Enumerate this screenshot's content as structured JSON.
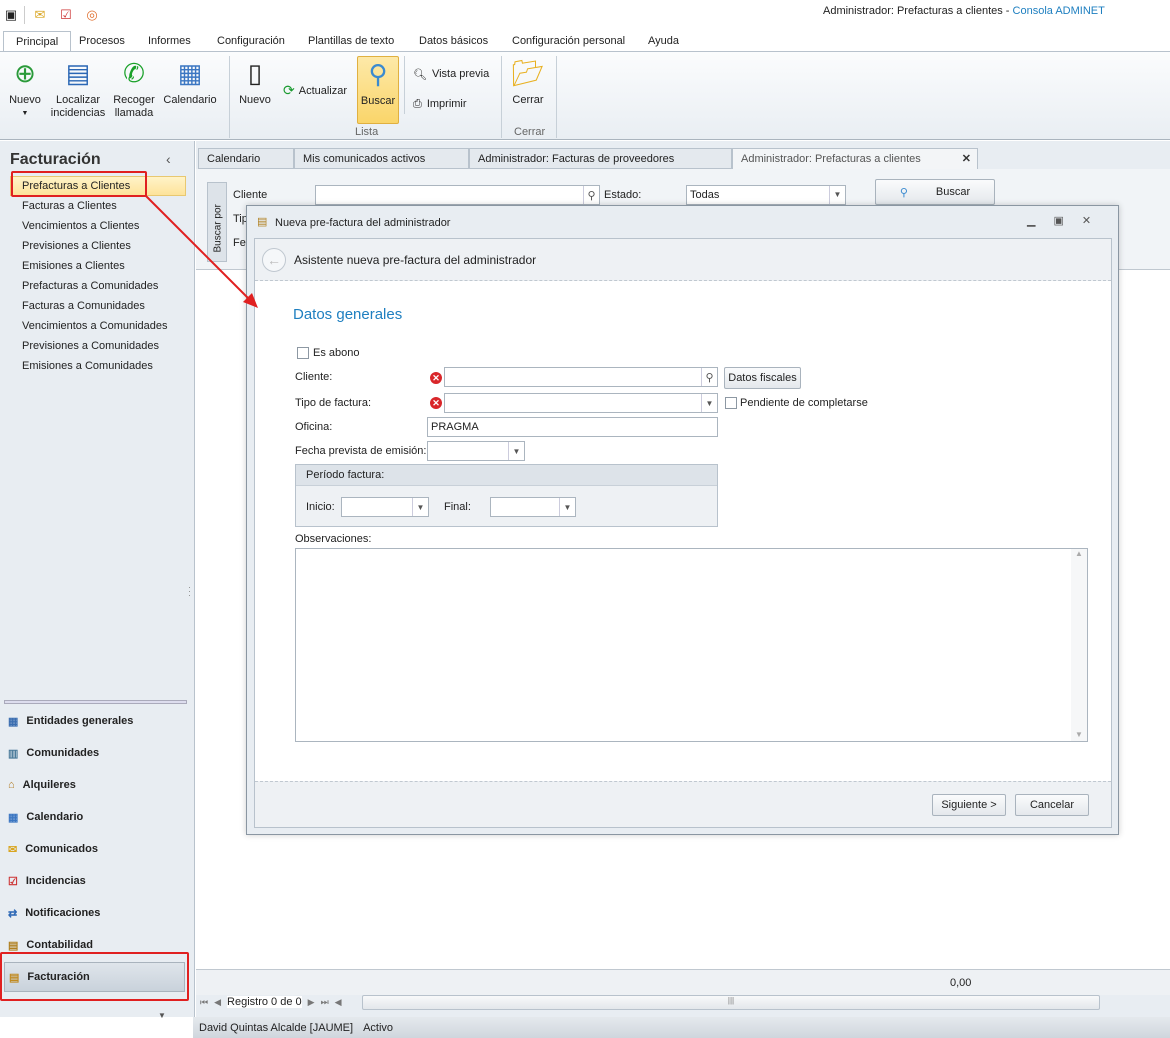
{
  "window": {
    "title": "Administrador: Prefacturas a clientes",
    "title_sep": " - ",
    "app": "Consola ADMINET"
  },
  "ribbon_tabs": [
    "Principal",
    "Procesos",
    "Informes",
    "Configuración",
    "Plantillas de texto",
    "Datos básicos",
    "Configuración personal",
    "Ayuda"
  ],
  "ribbon": {
    "nuevo": "Nuevo",
    "localizar": "Localizar incidencias",
    "recoger": "Recoger llamada",
    "calendario": "Calendario",
    "nuevo2": "Nuevo",
    "actualizar": "Actualizar",
    "buscar": "Buscar",
    "vista_previa": "Vista previa",
    "imprimir": "Imprimir",
    "lista": "Lista",
    "cerrar": "Cerrar",
    "cerrar_group": "Cerrar"
  },
  "left": {
    "title": "Facturación",
    "items": [
      "Prefacturas a Clientes",
      "Facturas a Clientes",
      "Vencimientos a Clientes",
      "Previsiones a Clientes",
      "Emisiones a Clientes",
      "Prefacturas a Comunidades",
      "Facturas a Comunidades",
      "Vencimientos a Comunidades",
      "Previsiones a Comunidades",
      "Emisiones a Comunidades"
    ],
    "modules": [
      "Entidades generales",
      "Comunidades",
      "Alquileres",
      "Calendario",
      "Comunicados",
      "Incidencias",
      "Notificaciones",
      "Contabilidad",
      "Facturación"
    ]
  },
  "doc_tabs": [
    "Calendario",
    "Mis comunicados activos",
    "Administrador: Facturas de proveedores",
    "Administrador: Prefacturas a clientes"
  ],
  "search": {
    "buscar_por": "Buscar por",
    "cliente": "Cliente",
    "tipo": "Tip",
    "fecha": "Fe",
    "estado": "Estado:",
    "estado_value": "Todas",
    "buscar": "Buscar"
  },
  "dialog": {
    "title": "Nueva pre-factura del administrador",
    "header": "Asistente nueva pre-factura del administrador",
    "section": "Datos generales",
    "es_abono": "Es abono",
    "cliente": "Cliente:",
    "datos_fiscales": "Datos fiscales",
    "tipo_factura": "Tipo de factura:",
    "pendiente": "Pendiente de completarse",
    "oficina": "Oficina:",
    "oficina_value": "PRAGMA",
    "fecha_prevista": "Fecha prevista de emisión:",
    "periodo": "Período factura:",
    "inicio": "Inicio:",
    "final": "Final:",
    "observaciones": "Observaciones:",
    "siguiente": "Siguiente >",
    "cancelar": "Cancelar"
  },
  "grid": {
    "total": "0,00",
    "registro": "Registro 0 de 0"
  },
  "status": {
    "user": "David Quintas Alcalde [JAUME]",
    "state": "Activo"
  },
  "colors": {
    "accent": "#1e7fc0",
    "highlight": "#fde9a8",
    "annotation": "#e02020"
  }
}
